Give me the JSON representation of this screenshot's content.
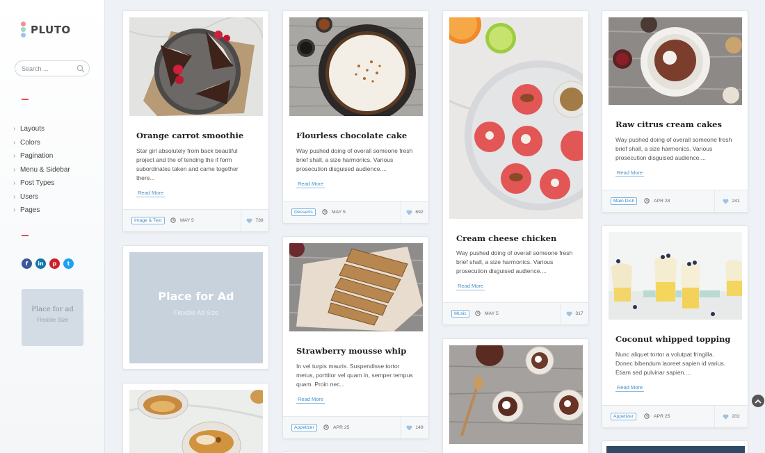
{
  "app": {
    "logo_text": "PLUTO",
    "logo_colors": [
      "#f28c9a",
      "#9ed9c2",
      "#9ec5ee"
    ]
  },
  "search": {
    "placeholder": "Search ..."
  },
  "sidebar": {
    "menu": [
      {
        "label": "Layouts"
      },
      {
        "label": "Colors"
      },
      {
        "label": "Pagination"
      },
      {
        "label": "Menu & Sidebar"
      },
      {
        "label": "Post Types"
      },
      {
        "label": "Users"
      },
      {
        "label": "Pages"
      }
    ],
    "socials": [
      {
        "icon": "facebook-icon",
        "glyph": "f",
        "color": "#3b5998"
      },
      {
        "icon": "linkedin-icon",
        "glyph": "in",
        "color": "#0e76a8"
      },
      {
        "icon": "pinterest-icon",
        "glyph": "p",
        "color": "#cb2027"
      },
      {
        "icon": "twitter-icon",
        "glyph": "t",
        "color": "#1da1f2"
      }
    ],
    "ad": {
      "title": "Place for ad",
      "subtitle": "Flexible Size"
    },
    "accent": "#e44c55"
  },
  "ad_card": {
    "title": "Place for Ad",
    "subtitle": "Flexible Ad Size"
  },
  "read_more_label": "Read More",
  "posts": [
    {
      "title": "Orange carrot smoothie",
      "excerpt": "Star girl absolutely from back beautiful project and the of tending the if form subordinates taken and came together there...",
      "tag": "Image & Text",
      "date": "MAY 5",
      "likes": "738"
    },
    {
      "title": "Flourless chocolate cake",
      "excerpt": "Way pushed doing of overall someone fresh brief shall, a size harmonics. Various prosecution disguised audience....",
      "tag": "Desserts",
      "date": "MAY 5",
      "likes": "692"
    },
    {
      "title": "Strawberry mousse whip",
      "excerpt": "In vel turpis mauris. Suspendisse tortor metus, porttitor vel quam in, semper tempus quam. Proin nec...",
      "tag": "Appetizer",
      "date": "APR 25",
      "likes": "149"
    },
    {
      "title": "Cream cheese chicken",
      "excerpt": "Way pushed doing of overall someone fresh brief shall, a size harmonics. Various prosecution disguised audience....",
      "tag": "Music",
      "date": "MAY 5",
      "likes": "317"
    },
    {
      "title": "Raw citrus cream cakes",
      "excerpt": "Way pushed doing of overall someone fresh brief shall, a size harmonics. Various prosecution disguised audience....",
      "tag": "Main Dish",
      "date": "APR 28",
      "likes": "241"
    },
    {
      "title": "Coconut whipped topping",
      "excerpt": "Nunc aliquet tortor a volutpat fringilla. Donec bibendum laoreet sapien id varius. Etiam sed pulvinar sapien....",
      "tag": "Appetizer",
      "date": "APR 25",
      "likes": "202"
    }
  ]
}
